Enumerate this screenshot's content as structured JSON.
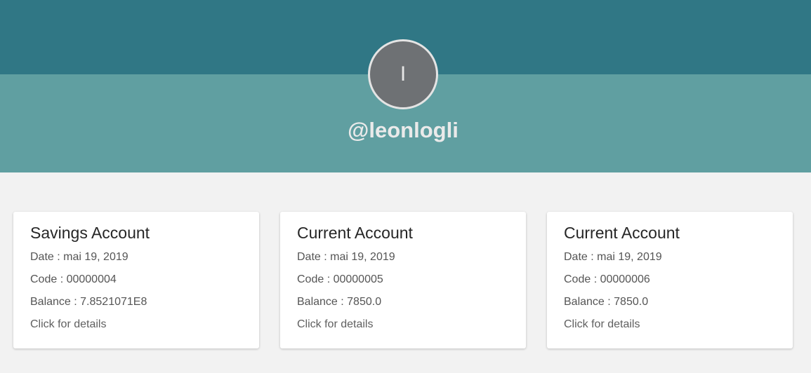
{
  "profile": {
    "avatar_initial": "I",
    "username": "@leonlogli"
  },
  "accounts": [
    {
      "title": "Savings Account",
      "date": "Date : mai 19, 2019",
      "code": "Code : 00000004",
      "balance": "Balance : 7.8521071E8",
      "details_link": "Click for details"
    },
    {
      "title": "Current Account",
      "date": "Date : mai 19, 2019",
      "code": "Code : 00000005",
      "balance": "Balance : 7850.0",
      "details_link": "Click for details"
    },
    {
      "title": "Current Account",
      "date": "Date : mai 19, 2019",
      "code": "Code : 00000006",
      "balance": "Balance : 7850.0",
      "details_link": "Click for details"
    }
  ],
  "colors": {
    "header_dark": "#307785",
    "header_light": "#609fa1",
    "background": "#f2f2f2",
    "avatar": "#6e7174"
  }
}
